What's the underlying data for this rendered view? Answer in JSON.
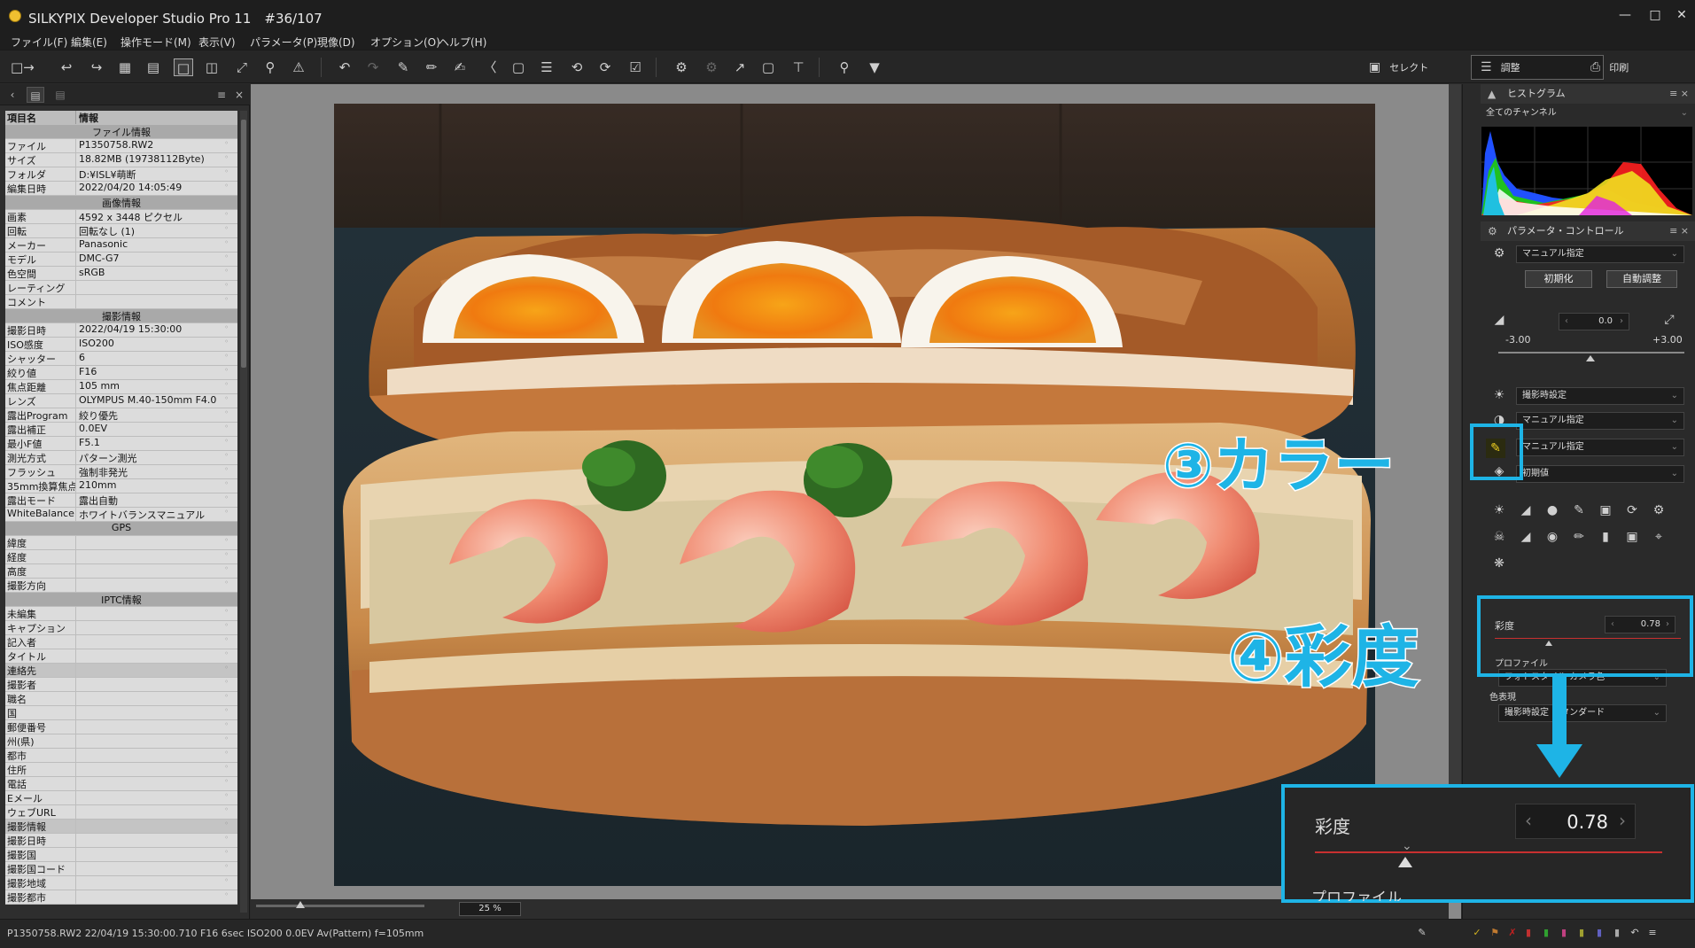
{
  "window": {
    "title": "SILKYPIX Developer Studio Pro 11　#36/107",
    "minimize": "—",
    "maximize": "□",
    "close": "✕"
  },
  "menu": [
    "ファイル(F)",
    "編集(E)",
    "操作モード(M)",
    "表示(V)",
    "パラメータ(P)",
    "現像(D)",
    "オプション(O)",
    "ヘルプ(H)"
  ],
  "modes": {
    "select": "セレクト",
    "adjust": "調整",
    "print": "印刷"
  },
  "info_table": {
    "header": {
      "key": "項目名",
      "value": "情報"
    },
    "rows": [
      {
        "type": "sec",
        "v": "ファイル情報"
      },
      {
        "k": "ファイル",
        "v": "P1350758.RW2"
      },
      {
        "k": "サイズ",
        "v": "18.82MB (19738112Byte)"
      },
      {
        "k": "フォルダ",
        "v": "D:¥ISL¥萌断"
      },
      {
        "k": "編集日時",
        "v": "2022/04/20 14:05:49"
      },
      {
        "type": "sec",
        "v": "画像情報"
      },
      {
        "k": "画素",
        "v": "4592 x 3448 ピクセル"
      },
      {
        "k": "回転",
        "v": "回転なし (1)"
      },
      {
        "k": "メーカー",
        "v": "Panasonic"
      },
      {
        "k": "モデル",
        "v": "DMC-G7"
      },
      {
        "k": "色空間",
        "v": "sRGB"
      },
      {
        "k": "レーティング",
        "v": ""
      },
      {
        "k": "コメント",
        "v": ""
      },
      {
        "type": "sec",
        "v": "撮影情報"
      },
      {
        "k": "撮影日時",
        "v": "2022/04/19 15:30:00"
      },
      {
        "k": "ISO感度",
        "v": "ISO200"
      },
      {
        "k": "シャッター",
        "v": "6"
      },
      {
        "k": "絞り値",
        "v": "F16"
      },
      {
        "k": "焦点距離",
        "v": "105 mm"
      },
      {
        "k": "レンズ",
        "v": "OLYMPUS M.40-150mm F4.0"
      },
      {
        "k": "露出Program",
        "v": "絞り優先"
      },
      {
        "k": "露出補正",
        "v": "0.0EV"
      },
      {
        "k": "最小F値",
        "v": "F5.1"
      },
      {
        "k": "測光方式",
        "v": "パターン測光"
      },
      {
        "k": "フラッシュ",
        "v": "強制非発光"
      },
      {
        "k": "35mm換算焦点",
        "v": "210mm"
      },
      {
        "k": "露出モード",
        "v": "露出自動"
      },
      {
        "k": "WhiteBalance",
        "v": "ホワイトバランスマニュアル"
      },
      {
        "type": "sec",
        "v": "GPS"
      },
      {
        "k": "緯度",
        "v": ""
      },
      {
        "k": "経度",
        "v": ""
      },
      {
        "k": "高度",
        "v": ""
      },
      {
        "k": "撮影方向",
        "v": ""
      },
      {
        "type": "sec",
        "v": "IPTC情報"
      },
      {
        "k": "未編集",
        "v": ""
      },
      {
        "k": "キャプション",
        "v": ""
      },
      {
        "k": "記入者",
        "v": ""
      },
      {
        "k": "タイトル",
        "v": ""
      },
      {
        "type": "grp",
        "k": "連絡先",
        "v": ""
      },
      {
        "k": "撮影者",
        "v": ""
      },
      {
        "k": "職名",
        "v": ""
      },
      {
        "k": "国",
        "v": ""
      },
      {
        "k": "郵便番号",
        "v": ""
      },
      {
        "k": "州(県)",
        "v": ""
      },
      {
        "k": "都市",
        "v": ""
      },
      {
        "k": "住所",
        "v": ""
      },
      {
        "k": "電話",
        "v": ""
      },
      {
        "k": "Eメール",
        "v": ""
      },
      {
        "k": "ウェブURL",
        "v": ""
      },
      {
        "type": "grp",
        "k": "撮影情報",
        "v": ""
      },
      {
        "k": "撮影日時",
        "v": ""
      },
      {
        "k": "撮影国",
        "v": ""
      },
      {
        "k": "撮影国コード",
        "v": ""
      },
      {
        "k": "撮影地域",
        "v": ""
      },
      {
        "k": "撮影都市",
        "v": ""
      }
    ]
  },
  "viewer": {
    "zoom": "25 %"
  },
  "histogram": {
    "title": "ヒストグラム",
    "channel": "全てのチャンネル"
  },
  "param_control": {
    "title": "パラメータ・コントロール",
    "preset": "マニュアル指定",
    "init_btn": "初期化",
    "auto_btn": "自動調整",
    "exposure": {
      "value": "0.0",
      "min": "-3.00",
      "max": "+3.00"
    },
    "wb": "撮影時設定",
    "tone": "マニュアル指定",
    "color": "マニュアル指定",
    "sharp": "初期値"
  },
  "saturation": {
    "label": "彩度",
    "value": "0.78",
    "level": 0.26,
    "profile_label": "プロファイル",
    "profile_value": "フォトスタイル カメラ色",
    "color_expr_label": "色表現",
    "color_expr_value": "撮影時設定 スタンダード"
  },
  "annotations": {
    "color": "③カラー",
    "saturation": "④彩度"
  },
  "zoomed": {
    "label": "彩度",
    "value": "0.78",
    "profile": "プロファイル"
  },
  "status": "P1350758.RW2 22/04/19 15:30:00.710 F16 6sec ISO200  0.0EV Av(Pattern) f=105mm",
  "colors": {
    "accent": "#1eb4e6"
  }
}
